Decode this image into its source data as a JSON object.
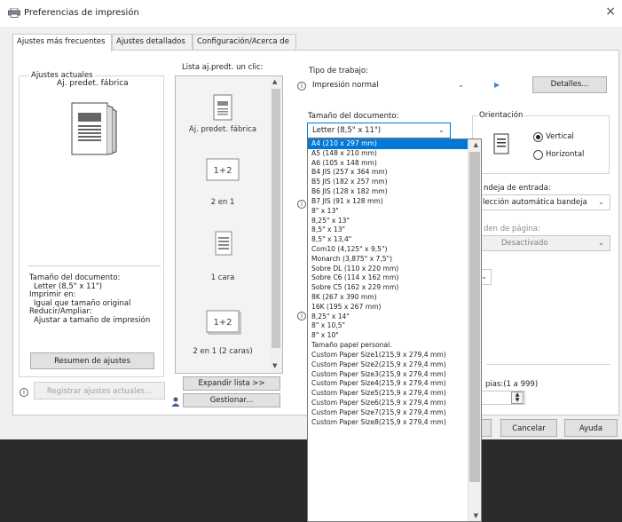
{
  "window": {
    "title": "Preferencias de impresión",
    "close_glyph": "×"
  },
  "tabs": [
    "Ajustes más frecuentes",
    "Ajustes detallados",
    "Configuración/Acerca de"
  ],
  "current": {
    "group_label": "Ajustes actuales",
    "preset_name": "Aj. predet. fábrica",
    "summary": [
      "Tamaño del documento:",
      "  Letter (8,5\" x 11\")",
      "Imprimir en:",
      "  Igual que tamaño original",
      "Reducir/Ampliar:",
      "  Ajustar a tamaño de impresión"
    ],
    "summary_button": "Resumen de ajustes",
    "register_button": "Registrar ajustes actuales..."
  },
  "presets": {
    "label": "Lista aj.predt. un clic:",
    "items": [
      "Aj. predet. fábrica",
      "2 en 1",
      "1 cara",
      "2 en 1 (2 caras)"
    ],
    "expand_button": "Expandir lista >>",
    "manage_button": "Gestionar..."
  },
  "job": {
    "label": "Tipo de trabajo:",
    "value": "Impresión normal",
    "details_button": "Detalles..."
  },
  "doc_size": {
    "label": "Tamaño del documento:",
    "value": "Letter (8,5\" x 11\")",
    "options": [
      "A4 (210 x 297 mm)",
      "A5 (148 x 210 mm)",
      "A6 (105 x 148 mm)",
      "B4 JIS (257 x 364 mm)",
      "B5 JIS (182 x 257 mm)",
      "B6 JIS (128 x 182 mm)",
      "B7 JIS (91 x 128 mm)",
      "8\" x 13\"",
      "8,25\" x 13\"",
      "8,5\" x 13\"",
      "8,5\" x 13,4\"",
      "Com10 (4,125\" x 9,5\")",
      "Monarch (3,875\" x 7,5\")",
      "Sobre DL (110 x 220 mm)",
      "Sobre C6 (114 x 162 mm)",
      "Sobre C5 (162 x 229 mm)",
      "8K (267 x 390 mm)",
      "16K (195 x 267 mm)",
      "8,25\" x 14\"",
      "8\" x 10,5\"",
      "8\" x 10\"",
      "Tamaño papel personal.",
      "Custom Paper Size1(215,9 x 279,4 mm)",
      "Custom Paper Size2(215,9 x 279,4 mm)",
      "Custom Paper Size3(215,9 x 279,4 mm)",
      "Custom Paper Size4(215,9 x 279,4 mm)",
      "Custom Paper Size5(215,9 x 279,4 mm)",
      "Custom Paper Size6(215,9 x 279,4 mm)",
      "Custom Paper Size7(215,9 x 279,4 mm)",
      "Custom Paper Size8(215,9 x 279,4 mm)"
    ],
    "selected_index": 0
  },
  "orientation": {
    "label": "Orientación",
    "portrait": "Vertical",
    "landscape": "Horizontal",
    "selected": "portrait"
  },
  "tray": {
    "label": "ndeja de entrada:",
    "value": "lección automática bandeja"
  },
  "page_sep": {
    "label": "den de página:",
    "value": "Desactivado"
  },
  "copies": {
    "label": "pias:(1 a 999)",
    "value": ""
  },
  "footer": {
    "ok": "",
    "cancel": "Cancelar",
    "help": "Ayuda"
  },
  "colors": {
    "accent": "#0078d7",
    "taskbar": "#2b2b2b",
    "dialog": "#f0f0f0"
  }
}
